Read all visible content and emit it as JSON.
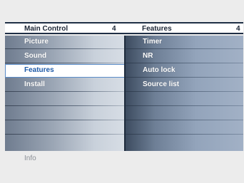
{
  "header": {
    "left_title": "Main Control",
    "left_count": "4",
    "right_title": "Features",
    "right_count": "4"
  },
  "left_menu": {
    "items": [
      {
        "label": "Picture"
      },
      {
        "label": "Sound"
      },
      {
        "label": "Features",
        "selected": true
      },
      {
        "label": "Install"
      },
      {
        "label": ""
      },
      {
        "label": ""
      },
      {
        "label": ""
      },
      {
        "label": ""
      }
    ]
  },
  "right_menu": {
    "items": [
      {
        "label": "Timer"
      },
      {
        "label": "NR"
      },
      {
        "label": "Auto lock"
      },
      {
        "label": "Source list"
      },
      {
        "label": ""
      },
      {
        "label": ""
      },
      {
        "label": ""
      },
      {
        "label": ""
      }
    ]
  },
  "footer": {
    "info_label": "Info"
  },
  "colors": {
    "header_border": "#1f2f45",
    "selection_text": "#1e5aa8",
    "selection_border": "#5a8cc8"
  }
}
